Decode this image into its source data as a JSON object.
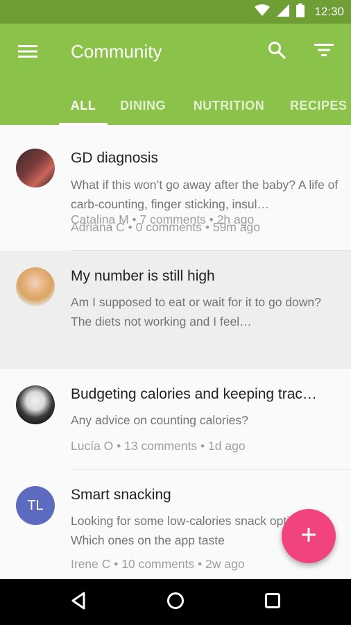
{
  "status_bar": {
    "time": "12:30",
    "icons": [
      "wifi-icon",
      "signal-icon",
      "battery-icon"
    ]
  },
  "app_bar": {
    "title": "Community",
    "icons": [
      "menu-icon",
      "search-icon",
      "filter-icon"
    ]
  },
  "tabs": [
    {
      "label": "ALL",
      "active": true
    },
    {
      "label": "DINING",
      "active": false
    },
    {
      "label": "NUTRITION",
      "active": false
    },
    {
      "label": "RECIPES",
      "active": false
    }
  ],
  "posts": [
    {
      "title": "GD diagnosis",
      "body": "What if this won’t go away after the baby? A life of carb-counting, finger sticking, insul…",
      "meta": "Adriana C • 0 comments • 59m ago"
    },
    {
      "title": "My number is still high",
      "body": "Am I supposed to eat or wait for it to go down? The diets not working and I feel…",
      "meta": "Catalina M • 7 comments • 2h ago"
    },
    {
      "title": "Budgeting calories and keeping trac…",
      "body": "Any advice on counting calories?",
      "meta": "Lucía O • 13 comments • 1d ago"
    },
    {
      "title": "Smart snacking",
      "avatar_initials": "TL",
      "body": "Looking for some low-calories snack options. Which ones on the app taste",
      "meta": "Irene C • 10 comments • 2w ago"
    }
  ],
  "fab": {
    "icon": "plus-icon"
  },
  "colors": {
    "primary": "#8bc34a",
    "status_bar": "#6e9e34",
    "accent": "#f1447e",
    "avatar_tl": "#5c6bc0"
  }
}
